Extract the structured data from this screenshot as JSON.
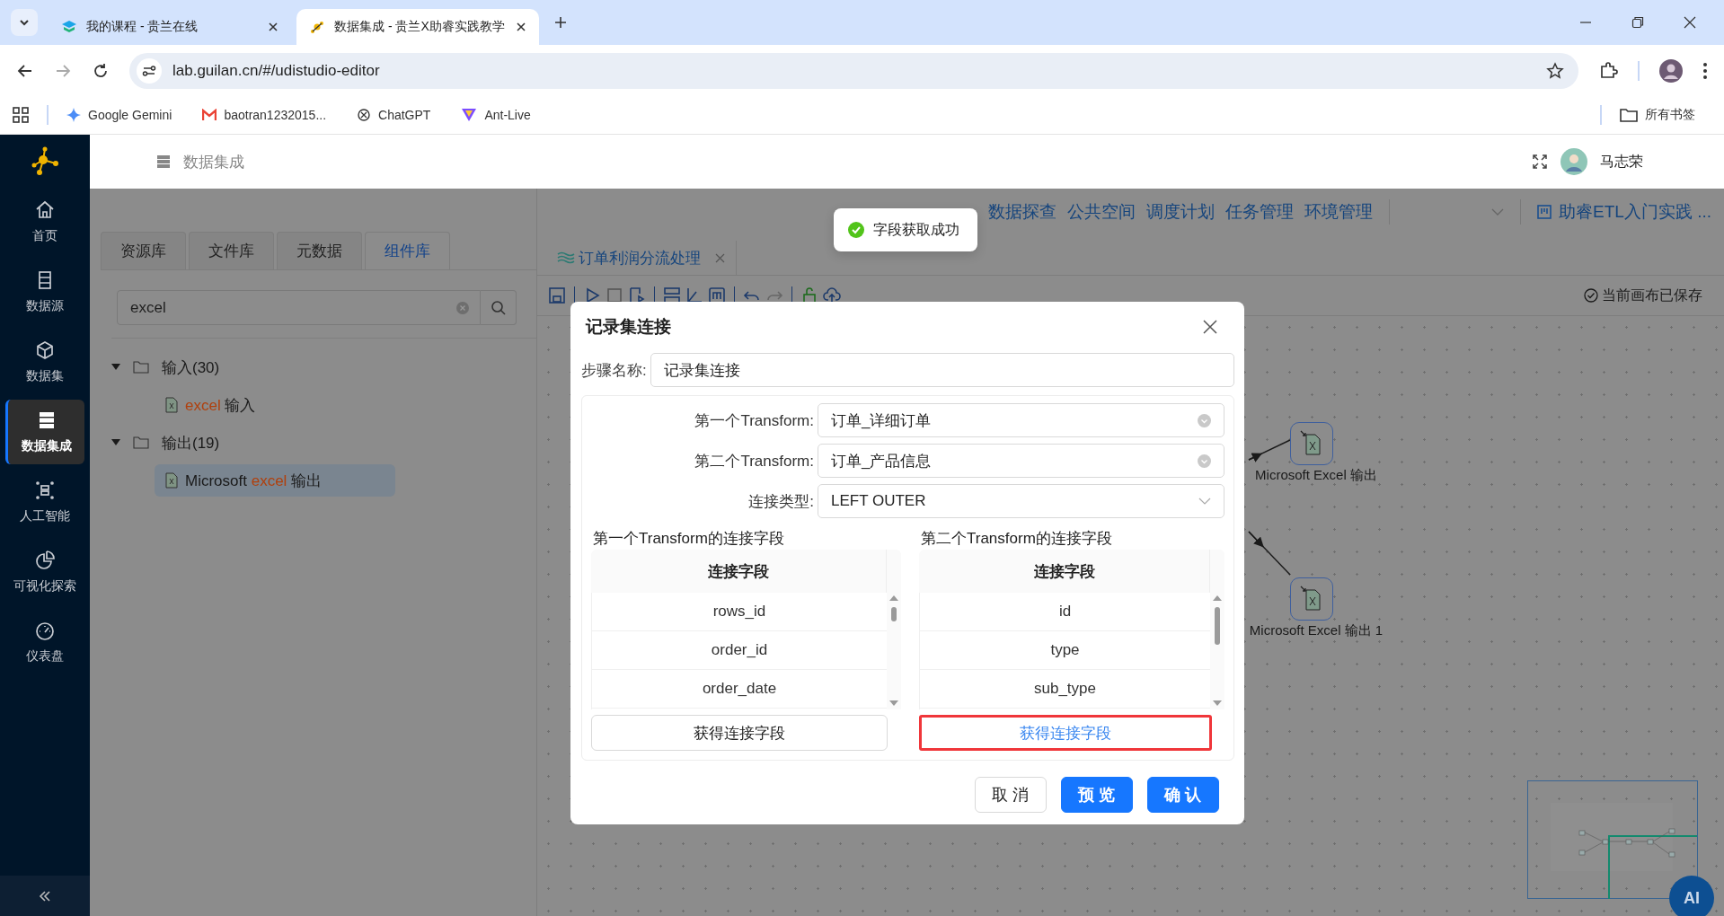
{
  "browser": {
    "tabs": [
      {
        "title": "我的课程 - 贵兰在线",
        "selected": false
      },
      {
        "title": "数据集成 - 贵兰X助睿实践教学",
        "selected": true
      }
    ],
    "url": "lab.guilan.cn/#/udistudio-editor",
    "bookmarks": [
      "Google Gemini",
      "baotran1232015...",
      "ChatGPT",
      "Ant-Live"
    ],
    "all_bookmarks": "所有书签"
  },
  "sidebar": [
    {
      "label": "首页",
      "selected": false
    },
    {
      "label": "数据源",
      "selected": false
    },
    {
      "label": "数据集",
      "selected": false
    },
    {
      "label": "数据集成",
      "selected": true
    },
    {
      "label": "人工智能",
      "selected": false
    },
    {
      "label": "可视化探索",
      "selected": false
    },
    {
      "label": "仪表盘",
      "selected": false
    }
  ],
  "header": {
    "title": "数据集成",
    "user": "马志荣"
  },
  "top_links": [
    "数据探查",
    "公共空间",
    "调度计划",
    "任务管理",
    "环境管理"
  ],
  "project": "助睿ETL入门实践 ...",
  "toast": "字段获取成功",
  "left_panel": {
    "tabs": [
      {
        "label": "资源库",
        "selected": false
      },
      {
        "label": "文件库",
        "selected": false
      },
      {
        "label": "元数据",
        "selected": false
      },
      {
        "label": "组件库",
        "selected": true
      }
    ],
    "search": "excel",
    "tree": [
      {
        "label": "输入(30)",
        "expanded": true,
        "children": [
          {
            "match": "excel",
            "suffix": " 输入",
            "selected": false
          }
        ]
      },
      {
        "label": "输出(19)",
        "expanded": true,
        "children": [
          {
            "prefix": "Microsoft ",
            "match": "excel",
            "suffix": " 输出",
            "selected": true
          }
        ]
      }
    ]
  },
  "editor": {
    "tab": "订单利润分流处理",
    "saved": "当前画布已保存",
    "nodes": [
      {
        "label": "Microsoft Excel 输出"
      },
      {
        "label": "Microsoft Excel 输出 1"
      }
    ],
    "ai": "AI"
  },
  "dialog": {
    "title": "记录集连接",
    "step_label": "步骤名称:",
    "step_value": "记录集连接",
    "fields": [
      {
        "label": "第一个Transform:",
        "value": "订单_详细订单",
        "kind": "clearable"
      },
      {
        "label": "第二个Transform:",
        "value": "订单_产品信息",
        "kind": "clearable"
      },
      {
        "label": "连接类型:",
        "value": "LEFT OUTER",
        "kind": "dropdown"
      }
    ],
    "tables": [
      {
        "caption": "第一个Transform的连接字段",
        "header": "连接字段",
        "rows": [
          "rows_id",
          "order_id",
          "order_date"
        ],
        "button": "获得连接字段",
        "highlighted": false
      },
      {
        "caption": "第二个Transform的连接字段",
        "header": "连接字段",
        "rows": [
          "id",
          "type",
          "sub_type"
        ],
        "button": "获得连接字段",
        "highlighted": true
      }
    ],
    "buttons": [
      {
        "label": "取 消",
        "kind": "default"
      },
      {
        "label": "预 览",
        "kind": "primary"
      },
      {
        "label": "确 认",
        "kind": "primary"
      }
    ]
  }
}
